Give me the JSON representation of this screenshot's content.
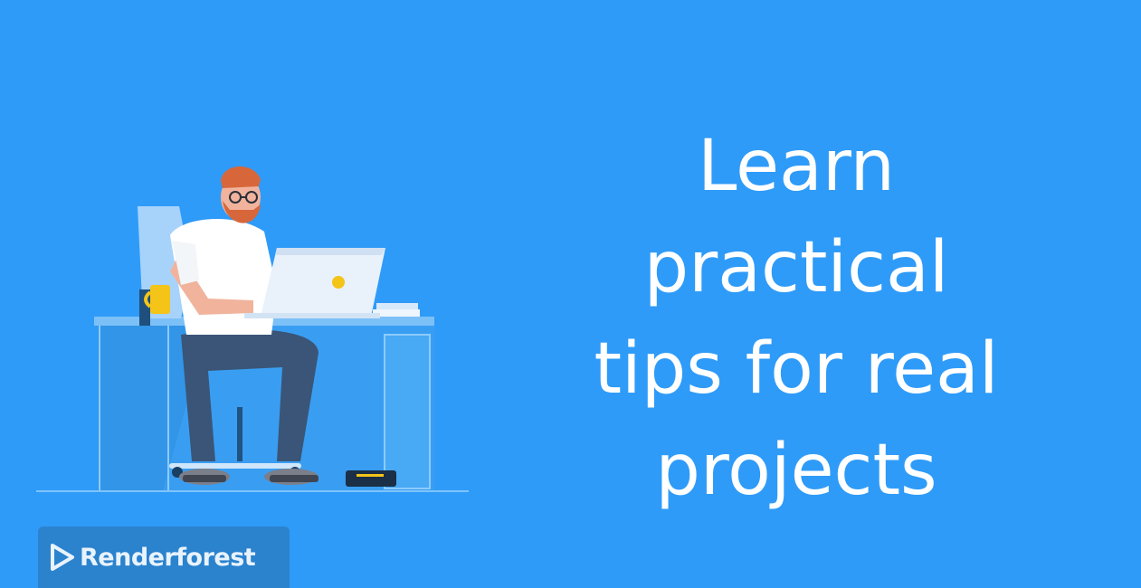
{
  "headline": {
    "lines": [
      "Learn",
      "practical",
      "tips for real",
      "projects"
    ]
  },
  "watermark": {
    "brand_name": "Renderforest",
    "icon": "play-triangle-icon"
  },
  "illustration": {
    "description_icon": "man-at-desk-illustration"
  },
  "colors": {
    "background": "#2f9bf8",
    "text": "#ffffff",
    "desk": "#4aa8f5",
    "shirt": "#ffffff",
    "pants": "#3a5577",
    "laptop": "#e9f1fb",
    "mug": "#f4c419",
    "hair": "#d7673a"
  }
}
